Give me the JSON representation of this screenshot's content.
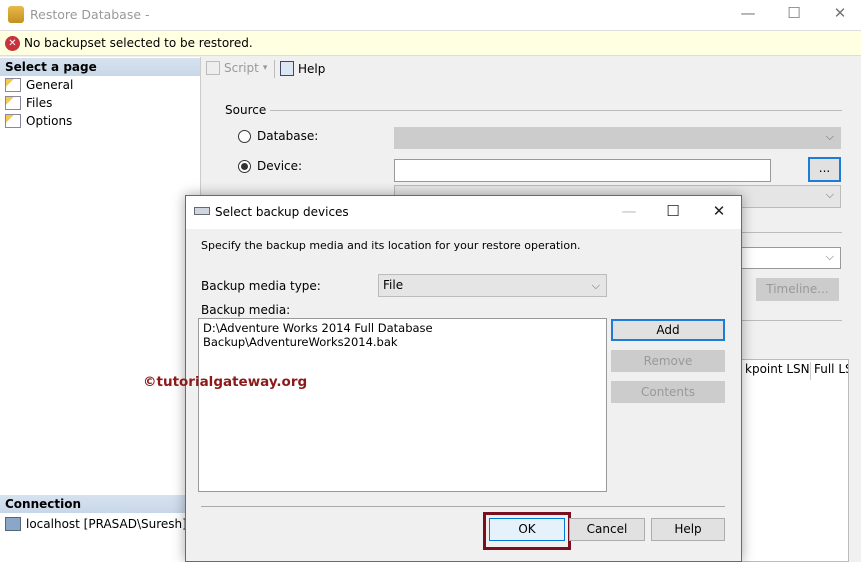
{
  "window": {
    "title": "Restore Database -",
    "minimize": "—",
    "maximize": "☐",
    "close": "✕"
  },
  "message": {
    "icon": "error-icon",
    "text": "No backupset selected to be restored."
  },
  "left_panel": {
    "header": "Select a page",
    "items": [
      {
        "label": "General"
      },
      {
        "label": "Files"
      },
      {
        "label": "Options"
      }
    ],
    "connection_header": "Connection",
    "connection": "localhost [PRASAD\\Suresh]"
  },
  "toolbar": {
    "script": "Script",
    "help": "Help"
  },
  "source": {
    "label": "Source",
    "database_label": "Database:",
    "device_label": "Device:",
    "device_value": "",
    "browse": "...",
    "timeline": "Timeline...",
    "grid_columns": [
      "kpoint LSN",
      "Full LS"
    ]
  },
  "dialog": {
    "title": "Select backup devices",
    "instructions": "Specify the backup media and its location for your restore operation.",
    "media_type_label": "Backup media type:",
    "media_type_value": "File",
    "media_label": "Backup media:",
    "media_items": [
      "D:\\Adventure Works 2014 Full Database Backup\\AdventureWorks2014.bak"
    ],
    "add": "Add",
    "remove": "Remove",
    "contents": "Contents",
    "ok": "OK",
    "cancel": "Cancel",
    "help": "Help"
  },
  "watermark": "©tutorialgateway.org",
  "colors": {
    "highlight": "#7a0f1f",
    "accent": "#1e7bd6"
  }
}
